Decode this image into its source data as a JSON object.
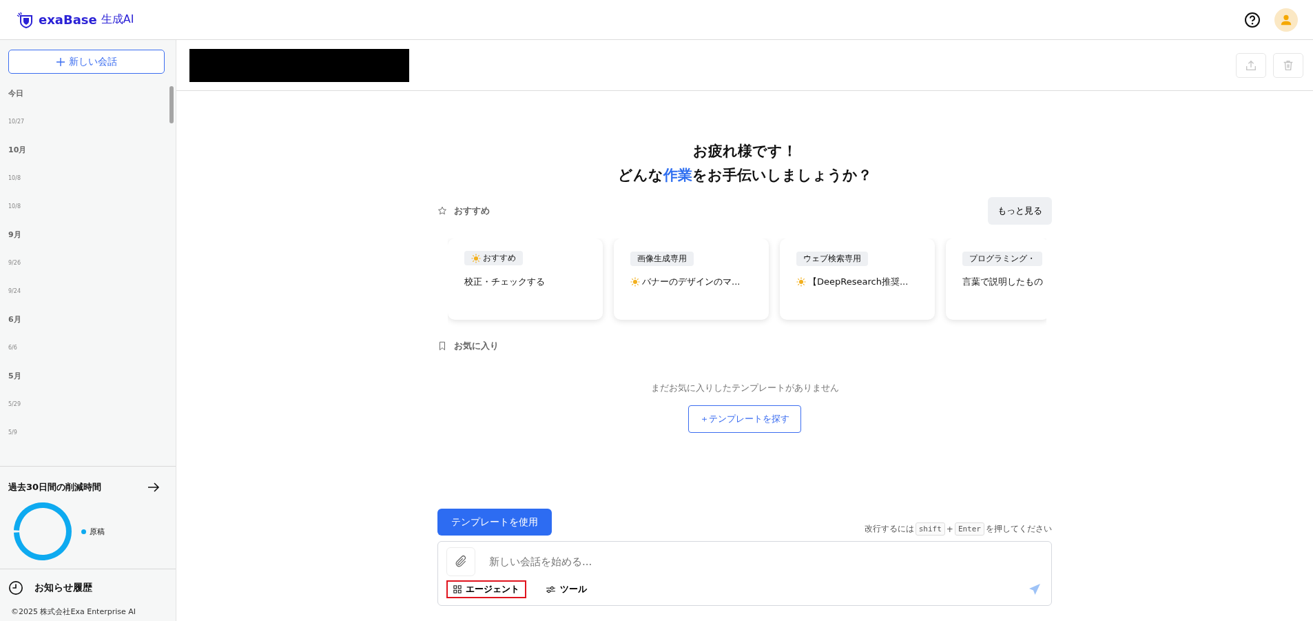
{
  "header": {
    "brand": "exaBase",
    "product": "生成AI"
  },
  "sidebar": {
    "new_chat": "新しい会話",
    "history": [
      {
        "label": "今日",
        "items": [
          "10/27"
        ]
      },
      {
        "label": "10月",
        "items": [
          "10/8",
          "10/8"
        ]
      },
      {
        "label": "9月",
        "items": [
          "9/26",
          "9/24"
        ]
      },
      {
        "label": "6月",
        "items": [
          "6/6"
        ]
      },
      {
        "label": "5月",
        "items": [
          "5/29",
          "5/9"
        ]
      }
    ],
    "savings": {
      "title": "過去30日間の削減時間",
      "legend": [
        {
          "label": "原稿",
          "color": "#0eaaf0"
        }
      ]
    },
    "notifications": "お知らせ履歴",
    "copyright": "©2025 株式会社Exa Enterprise AI"
  },
  "greeting": {
    "line1": "お疲れ様です！",
    "line2": "どんな**作業**をお手伝いしましょうか？"
  },
  "recommended": {
    "title": "おすすめ",
    "more": "もっと見る",
    "cards": [
      {
        "tag": "おすすめ",
        "tag_sun": true,
        "title": "校正・チェックする",
        "title_sun": false
      },
      {
        "tag": "画像生成専用",
        "tag_sun": false,
        "title": "バナーのデザインのマ...",
        "title_sun": true
      },
      {
        "tag": "ウェブ検索専用",
        "tag_sun": false,
        "title": "【DeepResearch推奨...",
        "title_sun": true
      },
      {
        "tag": "プログラミング・",
        "tag_sun": false,
        "title": "言葉で説明したもの",
        "title_sun": false
      }
    ]
  },
  "favorites": {
    "title": "お気に入り",
    "empty": "まだお気に入りしたテンプレートがありません",
    "find": "＋テンプレートを探す"
  },
  "composer": {
    "use_template": "テンプレートを使用",
    "hint": [
      {
        "kind": "text",
        "text": "改行するには"
      },
      {
        "kind": "key",
        "text": "shift"
      },
      {
        "kind": "text",
        "text": "+"
      },
      {
        "kind": "key",
        "text": "Enter"
      },
      {
        "kind": "text",
        "text": "を押してください"
      }
    ],
    "placeholder": "新しい会話を始める...",
    "tools": [
      {
        "kind": "agent",
        "label": "エージェント",
        "highlighted": true
      },
      {
        "kind": "tool",
        "label": "ツール",
        "highlighted": false
      }
    ]
  }
}
